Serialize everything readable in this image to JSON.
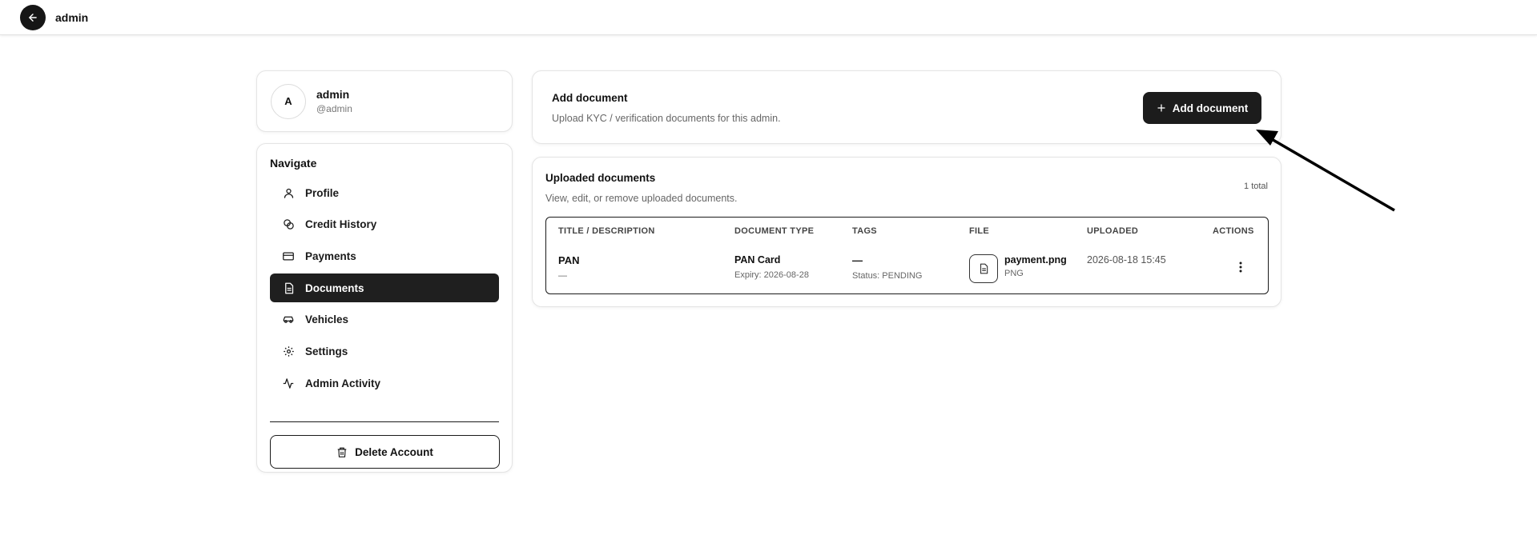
{
  "topbar": {
    "title": "admin",
    "back_icon": "arrow-left-icon"
  },
  "user": {
    "initial": "A",
    "name": "admin",
    "handle": "@admin"
  },
  "nav": {
    "heading": "Navigate",
    "items": [
      {
        "label": "Profile",
        "icon": "user-icon",
        "active": false
      },
      {
        "label": "Credit History",
        "icon": "coins-icon",
        "active": false
      },
      {
        "label": "Payments",
        "icon": "credit-card-icon",
        "active": false
      },
      {
        "label": "Documents",
        "icon": "document-icon",
        "active": true
      },
      {
        "label": "Vehicles",
        "icon": "car-icon",
        "active": false
      },
      {
        "label": "Settings",
        "icon": "gear-icon",
        "active": false
      },
      {
        "label": "Admin Activity",
        "icon": "activity-icon",
        "active": false
      }
    ],
    "delete_label": "Delete Account"
  },
  "add_document": {
    "title": "Add document",
    "subtitle": "Upload KYC / verification documents for this admin.",
    "button_label": "Add document"
  },
  "uploaded": {
    "title": "Uploaded documents",
    "subtitle": "View, edit, or remove uploaded documents.",
    "count_label": "1 total",
    "columns": [
      "TITLE / DESCRIPTION",
      "DOCUMENT TYPE",
      "TAGS",
      "FILE",
      "UPLOADED",
      "ACTIONS"
    ],
    "rows": [
      {
        "title": "PAN",
        "description": "—",
        "doc_type": "PAN Card",
        "expiry": "Expiry: 2026-08-28",
        "tags": "—",
        "status": "Status: PENDING",
        "file_name": "payment.png",
        "file_ext": "PNG",
        "uploaded": "2026-08-18 15:45"
      }
    ]
  }
}
